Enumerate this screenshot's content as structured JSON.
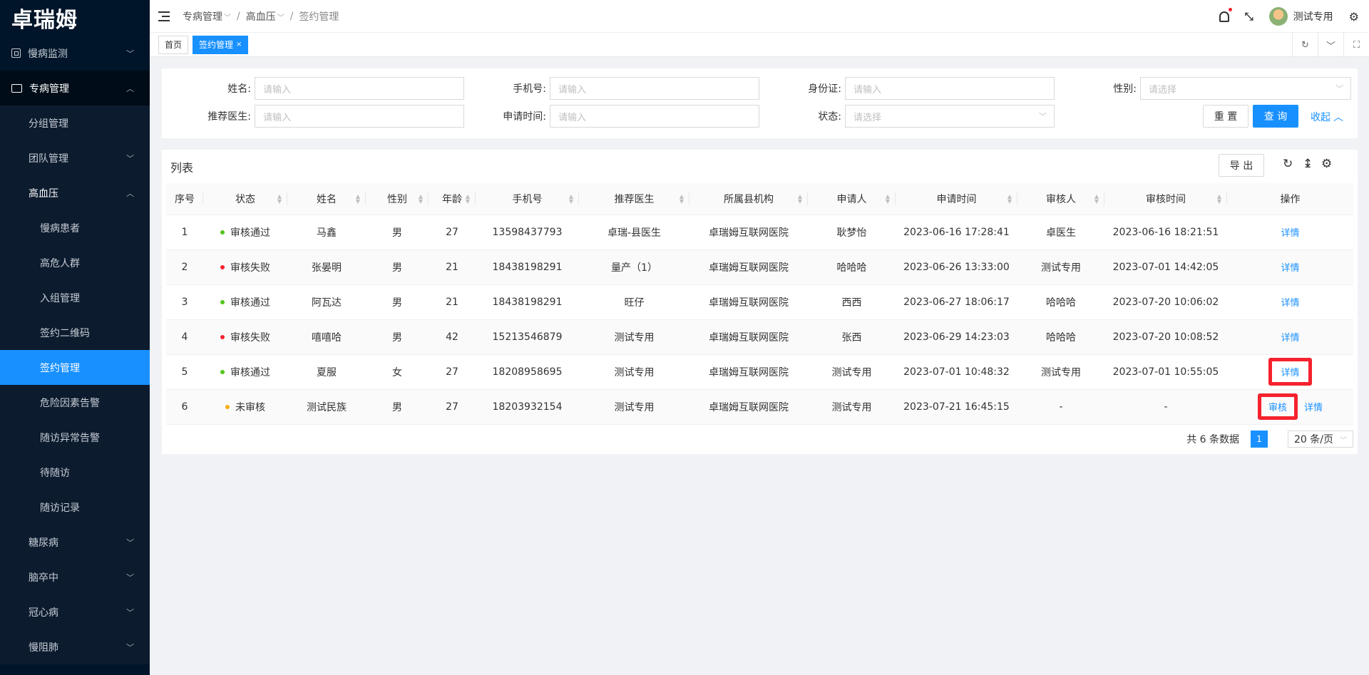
{
  "logo": "卓瑞姆",
  "sidebar": {
    "items": [
      {
        "label": "慢病监测"
      },
      {
        "label": "专病管理"
      },
      {
        "label": "分组管理"
      },
      {
        "label": "团队管理"
      },
      {
        "label": "高血压"
      },
      {
        "label": "慢病患者"
      },
      {
        "label": "高危人群"
      },
      {
        "label": "入组管理"
      },
      {
        "label": "签约二维码"
      },
      {
        "label": "签约管理"
      },
      {
        "label": "危险因素告警"
      },
      {
        "label": "随访异常告警"
      },
      {
        "label": "待随访"
      },
      {
        "label": "随访记录"
      },
      {
        "label": "糖尿病"
      },
      {
        "label": "脑卒中"
      },
      {
        "label": "冠心病"
      },
      {
        "label": "慢阻肺"
      }
    ]
  },
  "header": {
    "breadcrumb": [
      "专病管理",
      "高血压",
      "签约管理"
    ],
    "user_name": "测试专用"
  },
  "tabs": [
    {
      "label": "首页"
    },
    {
      "label": "签约管理"
    }
  ],
  "search": {
    "name_label": "姓名:",
    "phone_label": "手机号:",
    "idcard_label": "身份证:",
    "gender_label": "性别:",
    "doctor_label": "推荐医生:",
    "apply_time_label": "申请时间:",
    "status_label": "状态:",
    "input_placeholder": "请输入",
    "select_placeholder": "请选择",
    "reset_button": "重 置",
    "query_button": "查 询",
    "collapse_link": "收起"
  },
  "table": {
    "title": "列表",
    "export_button": "导 出",
    "columns": [
      "序号",
      "状态",
      "姓名",
      "性别",
      "年龄",
      "手机号",
      "推荐医生",
      "所属县机构",
      "申请人",
      "申请时间",
      "审核人",
      "审核时间",
      "操作"
    ],
    "rows": [
      {
        "no": "1",
        "status": "审核通过",
        "status_color": "#52c41a",
        "name": "马鑫",
        "gender": "男",
        "age": "27",
        "phone": "13598437793",
        "doctor": "卓瑞-县医生",
        "org": "卓瑞姆互联网医院",
        "applicant": "耿梦怡",
        "apply_time": "2023-06-16 17:28:41",
        "reviewer": "卓医生",
        "review_time": "2023-06-16 18:21:51",
        "detail": "详情"
      },
      {
        "no": "2",
        "status": "审核失败",
        "status_color": "#f5222d",
        "name": "张晏明",
        "gender": "男",
        "age": "21",
        "phone": "18438198291",
        "doctor": "量产（1）",
        "org": "卓瑞姆互联网医院",
        "applicant": "哈哈哈",
        "apply_time": "2023-06-26 13:33:00",
        "reviewer": "测试专用",
        "review_time": "2023-07-01 14:42:05",
        "detail": "详情"
      },
      {
        "no": "3",
        "status": "审核通过",
        "status_color": "#52c41a",
        "name": "阿瓦达",
        "gender": "男",
        "age": "21",
        "phone": "18438198291",
        "doctor": "旺仔",
        "org": "卓瑞姆互联网医院",
        "applicant": "西西",
        "apply_time": "2023-06-27 18:06:17",
        "reviewer": "哈哈哈",
        "review_time": "2023-07-20 10:06:02",
        "detail": "详情"
      },
      {
        "no": "4",
        "status": "审核失败",
        "status_color": "#f5222d",
        "name": "嘻嘻哈",
        "gender": "男",
        "age": "42",
        "phone": "15213546879",
        "doctor": "测试专用",
        "org": "卓瑞姆互联网医院",
        "applicant": "张西",
        "apply_time": "2023-06-29 14:23:03",
        "reviewer": "哈哈哈",
        "review_time": "2023-07-20 10:08:52",
        "detail": "详情"
      },
      {
        "no": "5",
        "status": "审核通过",
        "status_color": "#52c41a",
        "name": "夏服",
        "gender": "女",
        "age": "27",
        "phone": "18208958695",
        "doctor": "测试专用",
        "org": "卓瑞姆互联网医院",
        "applicant": "测试专用",
        "apply_time": "2023-07-01 10:48:32",
        "reviewer": "测试专用",
        "review_time": "2023-07-01 10:55:05",
        "detail": "详情"
      },
      {
        "no": "6",
        "status": "未审核",
        "status_color": "#faad14",
        "name": "测试民族",
        "gender": "男",
        "age": "27",
        "phone": "18203932154",
        "doctor": "测试专用",
        "org": "卓瑞姆互联网医院",
        "applicant": "测试专用",
        "apply_time": "2023-07-21 16:45:15",
        "reviewer": "-",
        "review_time": "-",
        "review": "审核",
        "detail": "详情"
      }
    ],
    "pagination": {
      "total_text": "共 6 条数据",
      "current_page": "1",
      "page_size": "20 条/页"
    }
  }
}
